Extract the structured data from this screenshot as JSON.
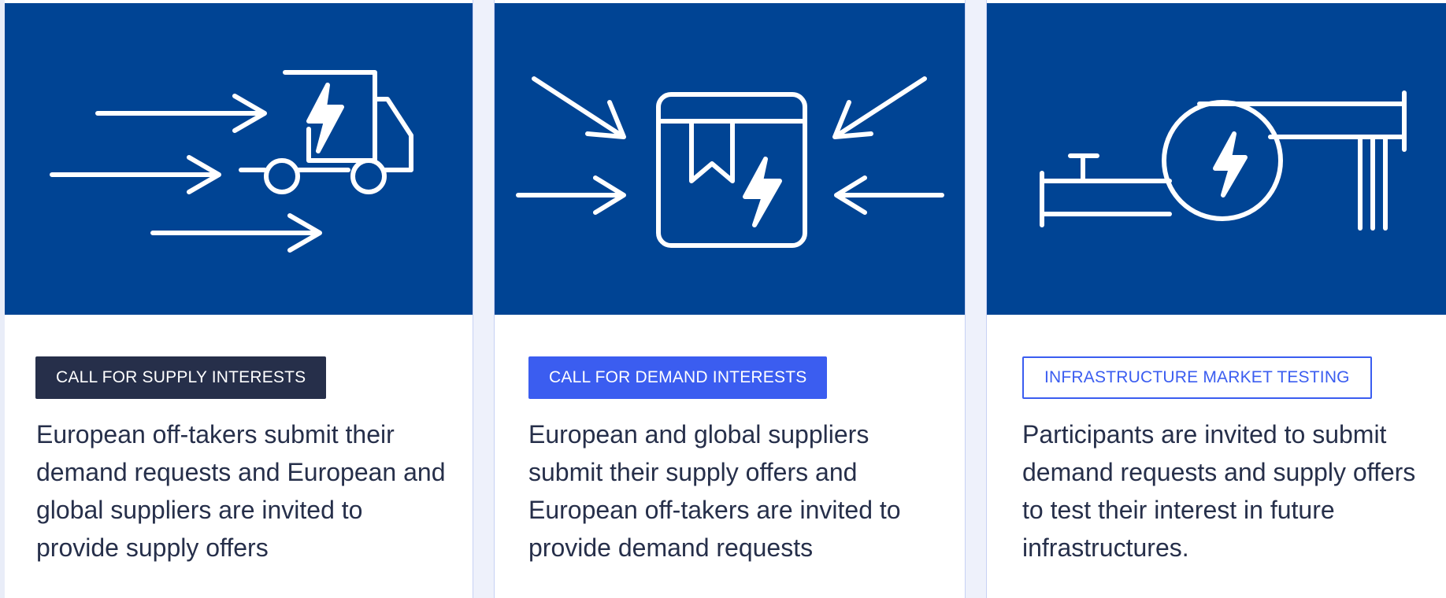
{
  "cards": [
    {
      "category": "CALL FOR SUPPLY INTERESTS",
      "category_style": "dark",
      "description": "European off-takers submit their demand requests and European and global suppliers are invited to provide supply offers",
      "icon": "truck-lightning-icon"
    },
    {
      "category": "CALL FOR DEMAND INTERESTS",
      "category_style": "blue",
      "description": "European and global suppliers submit their supply offers and European off-takers are invited to provide demand requests",
      "icon": "box-lightning-icon"
    },
    {
      "category": "INFRASTRUCTURE MARKET TESTING",
      "category_style": "outline",
      "description": "Participants are invited to submit demand requests and supply offers to test their interest in future infrastructures.",
      "icon": "pipeline-lightning-icon"
    }
  ],
  "colors": {
    "hero_blue": "#004494",
    "dark_badge": "#262f4a",
    "accent_blue": "#3b5df0",
    "text": "#262f4a"
  }
}
